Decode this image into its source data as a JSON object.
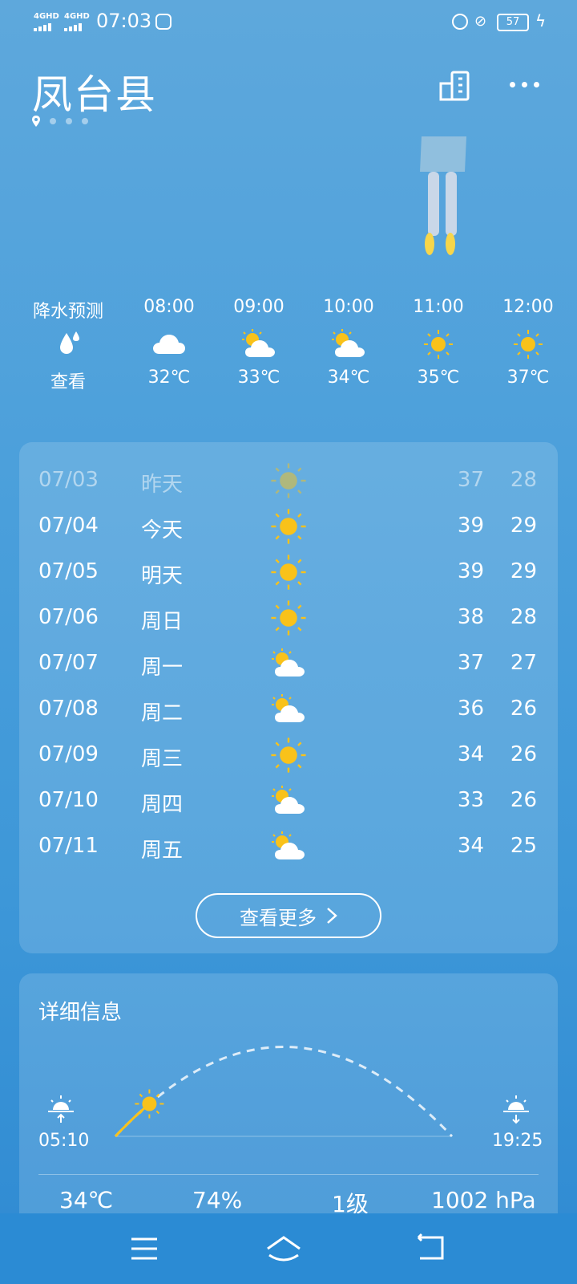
{
  "status_bar": {
    "sim1": "4GHD",
    "sim2": "4GHD",
    "time": "07:03",
    "battery": "57"
  },
  "header": {
    "city": "凤台县"
  },
  "hourly": [
    {
      "time": "降水预测",
      "icon": "raindrop-icon",
      "value": "查看"
    },
    {
      "time": "08:00",
      "icon": "cloud-icon",
      "value": "32℃"
    },
    {
      "time": "09:00",
      "icon": "partly-cloudy-icon",
      "value": "33℃"
    },
    {
      "time": "10:00",
      "icon": "partly-cloudy-icon",
      "value": "34℃"
    },
    {
      "time": "11:00",
      "icon": "sun-icon",
      "value": "35℃"
    },
    {
      "time": "12:00",
      "icon": "sun-icon",
      "value": "37℃"
    }
  ],
  "forecast": {
    "days": [
      {
        "date": "07/03",
        "dow": "昨天",
        "icon": "sun-icon",
        "high": "37",
        "low": "28"
      },
      {
        "date": "07/04",
        "dow": "今天",
        "icon": "sun-icon",
        "high": "39",
        "low": "29"
      },
      {
        "date": "07/05",
        "dow": "明天",
        "icon": "sun-icon",
        "high": "39",
        "low": "29"
      },
      {
        "date": "07/06",
        "dow": "周日",
        "icon": "sun-icon",
        "high": "38",
        "low": "28"
      },
      {
        "date": "07/07",
        "dow": "周一",
        "icon": "partly-cloudy-icon",
        "high": "37",
        "low": "27"
      },
      {
        "date": "07/08",
        "dow": "周二",
        "icon": "partly-cloudy-icon",
        "high": "36",
        "low": "26"
      },
      {
        "date": "07/09",
        "dow": "周三",
        "icon": "sun-icon",
        "high": "34",
        "low": "26"
      },
      {
        "date": "07/10",
        "dow": "周四",
        "icon": "partly-cloudy-icon",
        "high": "33",
        "low": "26"
      },
      {
        "date": "07/11",
        "dow": "周五",
        "icon": "partly-cloudy-icon",
        "high": "34",
        "low": "25"
      }
    ],
    "more_label": "查看更多"
  },
  "details": {
    "title": "详细信息",
    "sunrise": "05:10",
    "sunset": "19:25",
    "sun_progress": 0.12,
    "metrics": [
      "34℃",
      "74%",
      "1级",
      "1002 hPa"
    ]
  },
  "colors": {
    "sun": "#f9c21a",
    "background_top": "#5ea8dc",
    "background_bottom": "#2f8ad2",
    "nav_bar": "#2b8bd4"
  }
}
